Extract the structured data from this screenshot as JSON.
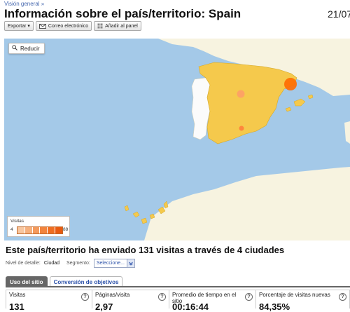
{
  "breadcrumb": "Visión general »",
  "title": "Información sobre el país/territorio: Spain",
  "date": "21/07",
  "toolbar": {
    "export_label": "Exportar ▾",
    "email_label": "Correo electrónico",
    "dashboard_label": "Añadir al panel"
  },
  "map": {
    "zoom_label": "Reducir",
    "legend": {
      "title": "Visitas",
      "min": "4",
      "max": "88"
    },
    "colors": {
      "sea": "#a4c9e8",
      "land": "#f7f3e0",
      "spain": "#f5c94c",
      "portugal": "#fbfbfb",
      "bubble": "#ff6a00"
    }
  },
  "summary": "Este país/territorio ha enviado 131 visitas a través de 4 ciudades",
  "detail": {
    "level_label": "Nivel de detalle:",
    "level_value": "Ciudad",
    "segment_label": "Segmento:",
    "segment_value": "Seleccione..."
  },
  "tabs": [
    {
      "label": "Uso del sitio"
    },
    {
      "label": "Conversión de objetivos"
    }
  ],
  "metrics": [
    {
      "label": "Visitas",
      "value": "131"
    },
    {
      "label": "Páginas/visita",
      "value": "2,97"
    },
    {
      "label": "Promedio de tiempo en el sitio",
      "value": "00:16:44"
    },
    {
      "label": "Porcentaje de visitas nuevas",
      "value": "84,35%"
    }
  ]
}
